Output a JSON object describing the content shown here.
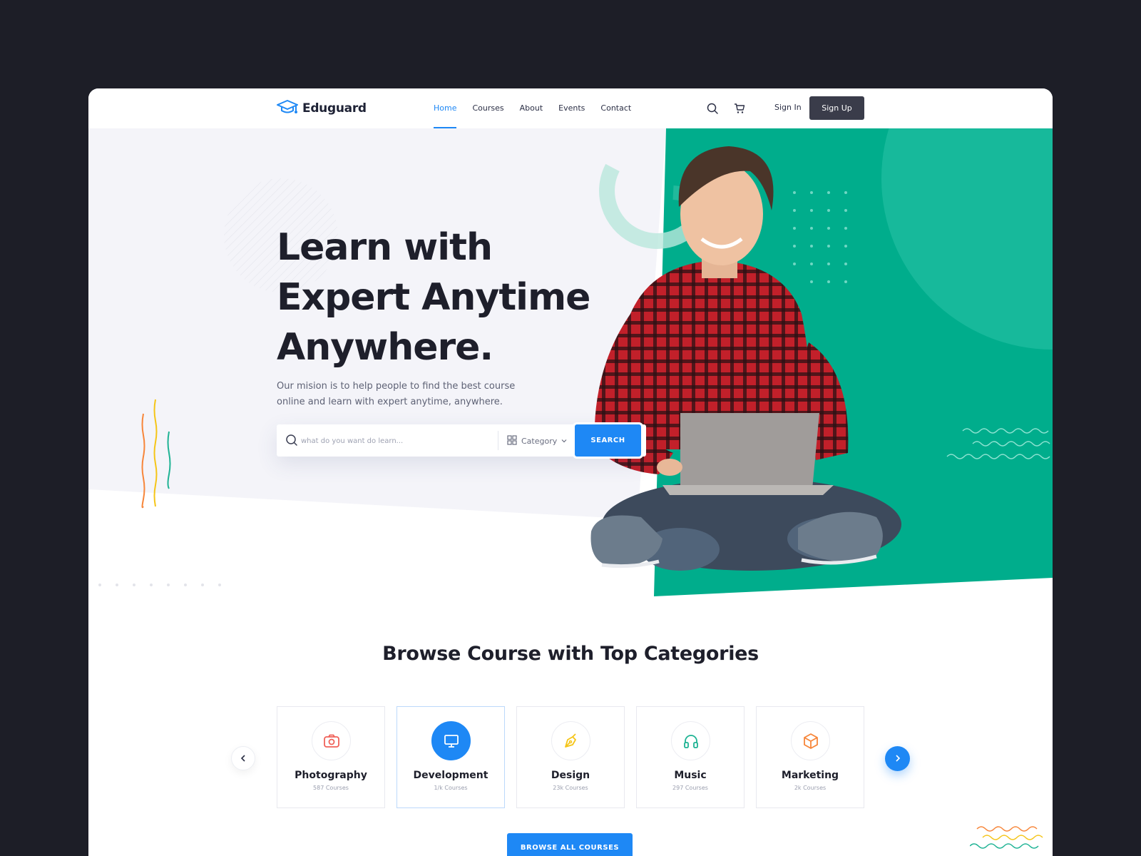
{
  "header": {
    "logo_text": "Eduguard",
    "nav": [
      {
        "label": "Home",
        "active": true
      },
      {
        "label": "Courses",
        "active": false
      },
      {
        "label": "About",
        "active": false
      },
      {
        "label": "Events",
        "active": false
      },
      {
        "label": "Contact",
        "active": false
      }
    ],
    "icons": [
      "search-icon",
      "cart-icon"
    ],
    "signin_label": "Sign In",
    "signup_label": "Sign Up"
  },
  "hero": {
    "headline_line1": "Learn with",
    "headline_line2": "Expert Anytime",
    "headline_line3": "Anywhere.",
    "subtext": "Our mision is to help people to find the best course online and learn with expert anytime, anywhere.",
    "search": {
      "placeholder": "what do you want do learn...",
      "category_label": "Category",
      "button_label": "SEARCH"
    },
    "image": "person-with-laptop"
  },
  "categories": {
    "title": "Browse Course with Top Categories",
    "items": [
      {
        "name": "Photography",
        "count": "587 Courses",
        "icon": "camera-icon",
        "color": "#f0625a",
        "active": false
      },
      {
        "name": "Development",
        "count": "1/k Courses",
        "icon": "monitor-icon",
        "color": "#ffffff",
        "active": true
      },
      {
        "name": "Design",
        "count": "23k Courses",
        "icon": "pen-tool-icon",
        "color": "#f5c518",
        "active": false
      },
      {
        "name": "Music",
        "count": "297 Courses",
        "icon": "headphones-icon",
        "color": "#1fb394",
        "active": false
      },
      {
        "name": "Marketing",
        "count": "2k Courses",
        "icon": "box-icon",
        "color": "#f7863a",
        "active": false
      }
    ],
    "browse_all_label": "BROWSE ALL COURSES"
  },
  "colors": {
    "accent": "#1e88f5",
    "green": "#00ad8c",
    "dark": "#1e1f2b",
    "page_bg": "#1d1e27"
  }
}
